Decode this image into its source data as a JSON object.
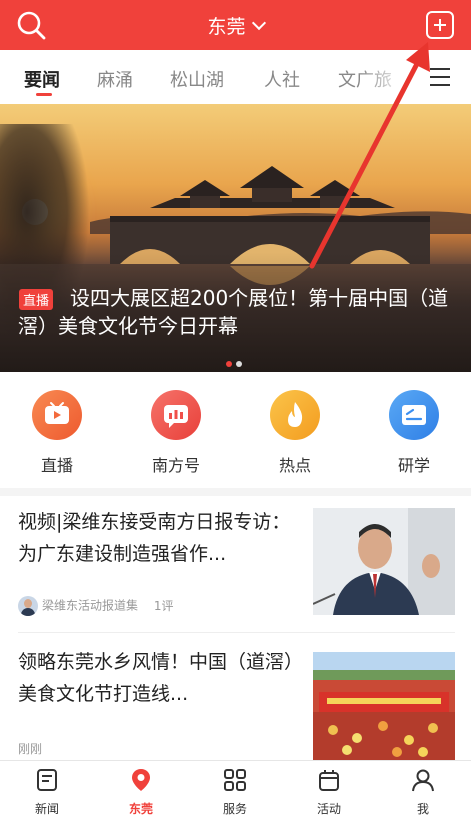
{
  "header": {
    "city": "东莞",
    "accent": "#f0413b",
    "icons": [
      "search-icon",
      "chevron-down-icon",
      "add-icon"
    ]
  },
  "tabs": [
    {
      "label": "要闻",
      "active": true
    },
    {
      "label": "麻涌",
      "active": false
    },
    {
      "label": "松山湖",
      "active": false
    },
    {
      "label": "人社",
      "active": false
    },
    {
      "label": "文广旅",
      "active": false
    }
  ],
  "banner": {
    "badge": "直播",
    "title": "设四大展区超200个展位！第十届中国（道滘）美食文化节今日开幕",
    "slide_count": 2,
    "active_slide": 1
  },
  "quick_links": [
    {
      "label": "直播",
      "icon": "tv-icon",
      "color": "#f36a3c"
    },
    {
      "label": "南方号",
      "icon": "chart-bubble-icon",
      "color": "#f0504a"
    },
    {
      "label": "热点",
      "icon": "flame-icon",
      "color": "#f5a623"
    },
    {
      "label": "研学",
      "icon": "card-icon",
      "color": "#3b8ff0"
    }
  ],
  "news": [
    {
      "title": "视频|梁维东接受南方日报专访：为广东建设制造强省作...",
      "source": "梁维东活动报道集",
      "comments": "1评"
    },
    {
      "title": "领略东莞水乡风情！中国（道滘）美食文化节打造线...",
      "time": "刚刚"
    }
  ],
  "bottom_nav": [
    {
      "label": "新闻",
      "icon": "news-icon",
      "active": false
    },
    {
      "label": "东莞",
      "icon": "location-pin-icon",
      "active": true
    },
    {
      "label": "服务",
      "icon": "grid-icon",
      "active": false
    },
    {
      "label": "活动",
      "icon": "calendar-icon",
      "active": false
    },
    {
      "label": "我",
      "icon": "user-icon",
      "active": false
    }
  ],
  "annotation": {
    "icon": "red-arrow-icon",
    "color": "#e8352e"
  }
}
